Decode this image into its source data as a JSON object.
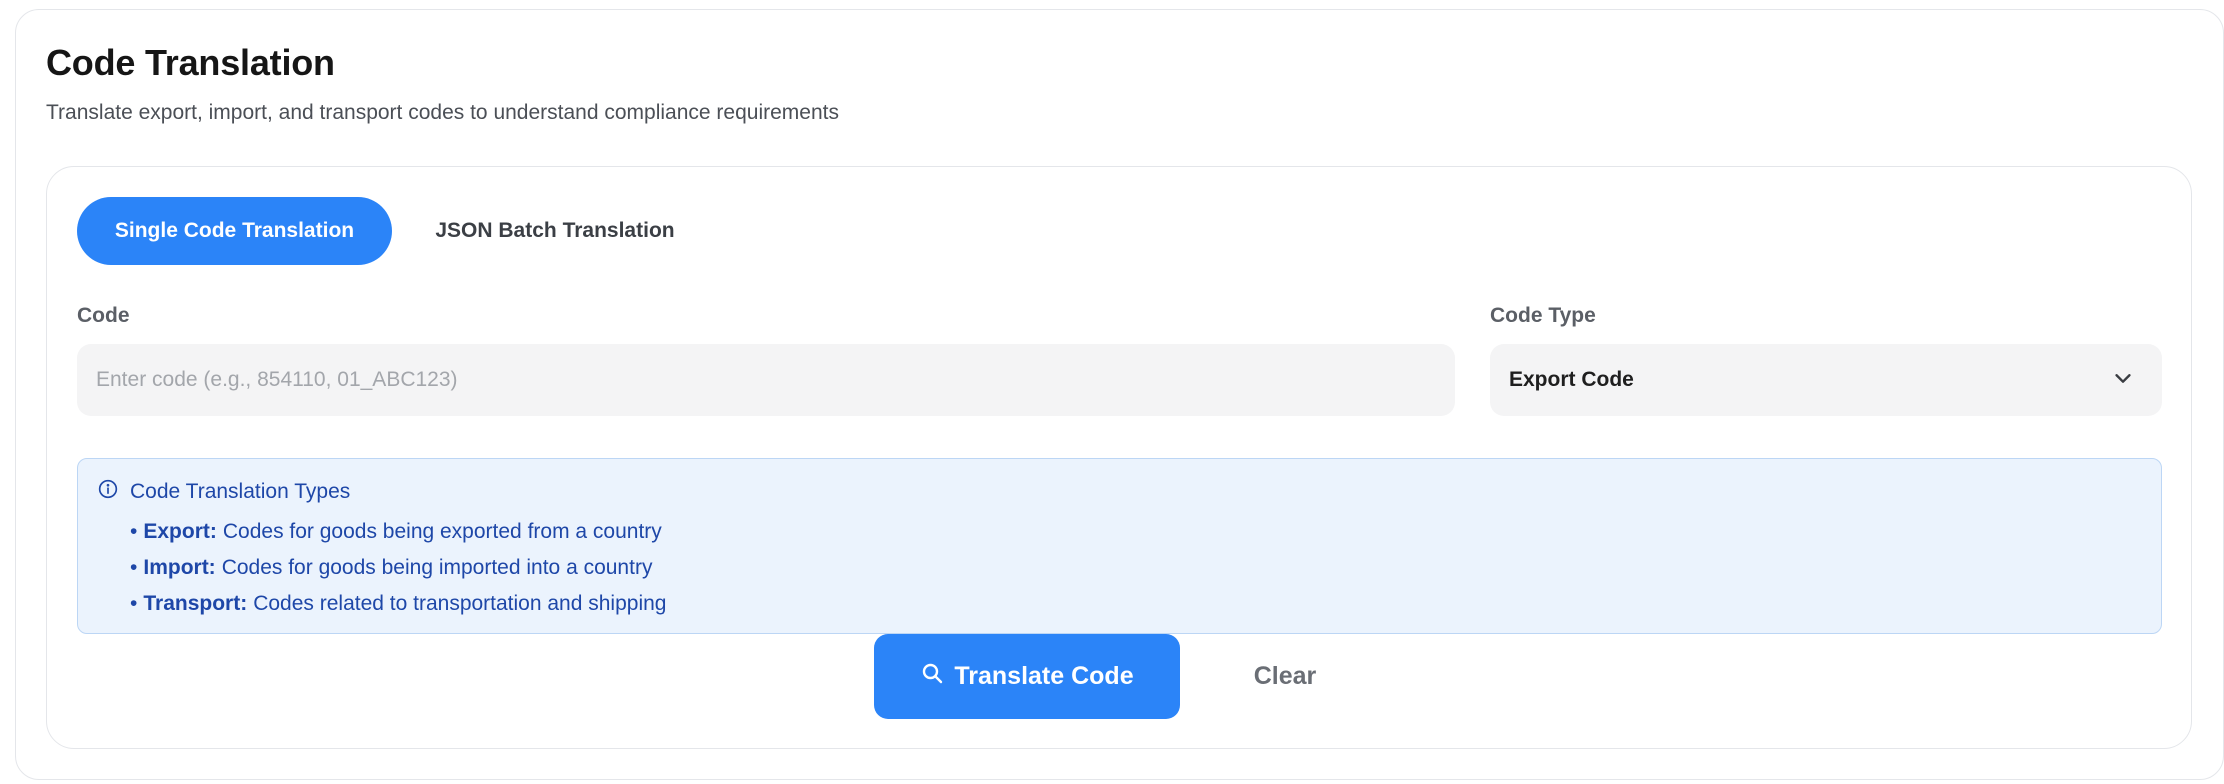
{
  "header": {
    "title": "Code Translation",
    "subtitle": "Translate export, import, and transport codes to understand compliance requirements"
  },
  "tabs": [
    {
      "label": "Single Code Translation",
      "active": true
    },
    {
      "label": "JSON Batch Translation",
      "active": false
    }
  ],
  "form": {
    "code_label": "Code",
    "code_placeholder": "Enter code (e.g., 854110, 01_ABC123)",
    "code_value": "",
    "code_type_label": "Code Type",
    "code_type_value": "Export Code"
  },
  "info": {
    "title": "Code Translation Types",
    "items": [
      {
        "term": "Export:",
        "description": "Codes for goods being exported from a country"
      },
      {
        "term": "Import:",
        "description": "Codes for goods being imported into a country"
      },
      {
        "term": "Transport:",
        "description": "Codes related to transportation and shipping"
      }
    ]
  },
  "actions": {
    "translate_label": "Translate Code",
    "clear_label": "Clear"
  },
  "icons": {
    "info": "info-circle-icon",
    "chevron": "chevron-down-icon",
    "search": "search-icon"
  },
  "colors": {
    "accent": "#2b84f8",
    "info_bg": "#ebf3fd",
    "info_text": "#1e47a8",
    "input_bg": "#f4f4f5"
  }
}
